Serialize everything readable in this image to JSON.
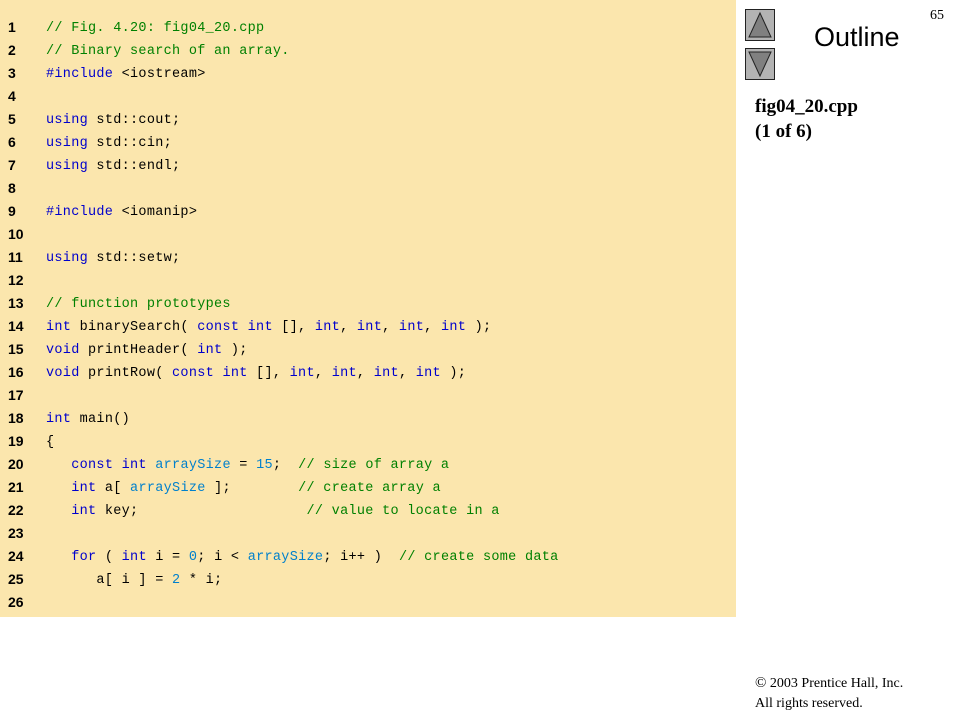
{
  "slide": {
    "number": "65",
    "outline_label": "Outline",
    "file_name": "fig04_20.cpp",
    "page_of": "(1 of 6)",
    "copyright_symbol": "©",
    "copyright_line1": "2003 Prentice Hall, Inc.",
    "copyright_line2": "All rights reserved."
  },
  "nav": {
    "up_icon": "triangle-up-icon",
    "down_icon": "triangle-down-icon",
    "button_color": "#b3b3b3"
  },
  "colors": {
    "panel_bg": "#fbe6ad",
    "keyword": "#0000cc",
    "comment": "#008000",
    "identifier": "#0080cc",
    "plain": "#000000"
  },
  "code_lines": [
    {
      "n": "1",
      "segs": [
        [
          "cm",
          "// Fig. 4.20: fig04_20.cpp"
        ]
      ]
    },
    {
      "n": "2",
      "segs": [
        [
          "cm",
          "// Binary search of an array."
        ]
      ]
    },
    {
      "n": "3",
      "segs": [
        [
          "kw",
          "#include "
        ],
        [
          "pl",
          "<iostream>"
        ]
      ]
    },
    {
      "n": "4",
      "segs": []
    },
    {
      "n": "5",
      "segs": [
        [
          "kw",
          "using "
        ],
        [
          "pl",
          "std::cout;"
        ]
      ]
    },
    {
      "n": "6",
      "segs": [
        [
          "kw",
          "using "
        ],
        [
          "pl",
          "std::cin;"
        ]
      ]
    },
    {
      "n": "7",
      "segs": [
        [
          "kw",
          "using "
        ],
        [
          "pl",
          "std::endl;"
        ]
      ]
    },
    {
      "n": "8",
      "segs": []
    },
    {
      "n": "9",
      "segs": [
        [
          "kw",
          "#include "
        ],
        [
          "pl",
          "<iomanip>"
        ]
      ]
    },
    {
      "n": "10",
      "segs": []
    },
    {
      "n": "11",
      "segs": [
        [
          "kw",
          "using "
        ],
        [
          "pl",
          "std::setw;"
        ]
      ]
    },
    {
      "n": "12",
      "segs": []
    },
    {
      "n": "13",
      "segs": [
        [
          "cm",
          "// function prototypes"
        ]
      ]
    },
    {
      "n": "14",
      "segs": [
        [
          "kw",
          "int "
        ],
        [
          "pl",
          "binarySearch( "
        ],
        [
          "kw",
          "const int "
        ],
        [
          "pl",
          "[], "
        ],
        [
          "kw",
          "int"
        ],
        [
          "pl",
          ", "
        ],
        [
          "kw",
          "int"
        ],
        [
          "pl",
          ", "
        ],
        [
          "kw",
          "int"
        ],
        [
          "pl",
          ", "
        ],
        [
          "kw",
          "int "
        ],
        [
          "pl",
          ");"
        ]
      ]
    },
    {
      "n": "15",
      "segs": [
        [
          "kw",
          "void "
        ],
        [
          "pl",
          "printHeader( "
        ],
        [
          "kw",
          "int "
        ],
        [
          "pl",
          ");"
        ]
      ]
    },
    {
      "n": "16",
      "segs": [
        [
          "kw",
          "void "
        ],
        [
          "pl",
          "printRow( "
        ],
        [
          "kw",
          "const int "
        ],
        [
          "pl",
          "[], "
        ],
        [
          "kw",
          "int"
        ],
        [
          "pl",
          ", "
        ],
        [
          "kw",
          "int"
        ],
        [
          "pl",
          ", "
        ],
        [
          "kw",
          "int"
        ],
        [
          "pl",
          ", "
        ],
        [
          "kw",
          "int "
        ],
        [
          "pl",
          ");"
        ]
      ]
    },
    {
      "n": "17",
      "segs": []
    },
    {
      "n": "18",
      "segs": [
        [
          "kw",
          "int "
        ],
        [
          "pl",
          "main()"
        ]
      ]
    },
    {
      "n": "19",
      "segs": [
        [
          "pl",
          "{"
        ]
      ]
    },
    {
      "n": "20",
      "segs": [
        [
          "pl",
          "   "
        ],
        [
          "kw",
          "const int "
        ],
        [
          "id",
          "arraySize"
        ],
        [
          "pl",
          " = "
        ],
        [
          "id",
          "15"
        ],
        [
          "pl",
          ";  "
        ],
        [
          "cm",
          "// size of array a"
        ]
      ]
    },
    {
      "n": "21",
      "segs": [
        [
          "pl",
          "   "
        ],
        [
          "kw",
          "int "
        ],
        [
          "pl",
          "a[ "
        ],
        [
          "id",
          "arraySize"
        ],
        [
          "pl",
          " ];        "
        ],
        [
          "cm",
          "// create array a"
        ]
      ]
    },
    {
      "n": "22",
      "segs": [
        [
          "pl",
          "   "
        ],
        [
          "kw",
          "int "
        ],
        [
          "pl",
          "key;                    "
        ],
        [
          "cm",
          "// value to locate in a"
        ]
      ]
    },
    {
      "n": "23",
      "segs": []
    },
    {
      "n": "24",
      "segs": [
        [
          "pl",
          "   "
        ],
        [
          "kw",
          "for "
        ],
        [
          "pl",
          "( "
        ],
        [
          "kw",
          "int "
        ],
        [
          "pl",
          "i = "
        ],
        [
          "id",
          "0"
        ],
        [
          "pl",
          "; i < "
        ],
        [
          "id",
          "arraySize"
        ],
        [
          "pl",
          "; i++ )  "
        ],
        [
          "cm",
          "// create some data"
        ]
      ]
    },
    {
      "n": "25",
      "segs": [
        [
          "pl",
          "      a[ i ] = "
        ],
        [
          "id",
          "2"
        ],
        [
          "pl",
          " * i;"
        ]
      ]
    },
    {
      "n": "26",
      "segs": []
    }
  ]
}
